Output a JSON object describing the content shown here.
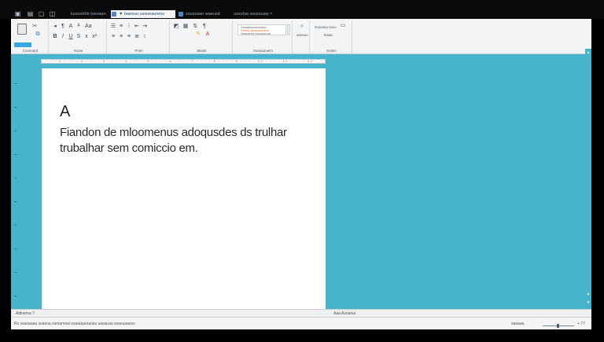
{
  "taskbar": {
    "icons": [
      "monitor-icon",
      "folder-icon",
      "app-icon",
      "app-icon-2"
    ],
    "tabs": [
      {
        "label": "iussomhb toevaan",
        "active": false
      },
      {
        "label": "▼ baesuu ussueaureos",
        "active": true,
        "close": "× ×"
      },
      {
        "label": "ssussaan waeusd",
        "active": false
      },
      {
        "label": "ussuhai  ssussuaw  ×",
        "active": false
      }
    ]
  },
  "ribbon": {
    "groups": [
      {
        "label": "Ccerioard"
      },
      {
        "label": "Ssote"
      },
      {
        "label": "Pmin"
      },
      {
        "label": "Masle"
      },
      {
        "label": "Sseuaonelrs"
      },
      {
        "label": "Sotien"
      }
    ],
    "styles_lines": [
      "Sosaassoaucsuau",
      "Hssss ussaaasuaus",
      "Ssaoanes usssasuoa"
    ],
    "misc": [
      "aaosuu",
      "ssaoauu  ssoo",
      "Eaaa"
    ]
  },
  "ruler": {
    "text": "· · · · 1 · · · · 2 · · · · 3 · · · · 4 · · · · 5 · · · · 6 · · · · 7 · · · · 8 · · · · 9 · · · · 10 · · · · 11 · · · · 12 · ·"
  },
  "document": {
    "heading": "A",
    "lines": [
      "Fiandon de mloomenus adoqusdes ds trulhar",
      "trubalhar sem comiccio em."
    ]
  },
  "statusbar": {
    "left": "Adinema  7",
    "center": "Aaa Asoanui",
    "left2": "Rs  ssaoaaaa  ssaoua  ssmarnsai  soaaauuoauas  uasauaa  ssaouaasso",
    "right": "saaaaa",
    "zoom_right": "+ 77"
  },
  "colors": {
    "workspace": "#46b5cc",
    "ribbon": "#f3f4f5",
    "accent": "#38a8e0"
  }
}
